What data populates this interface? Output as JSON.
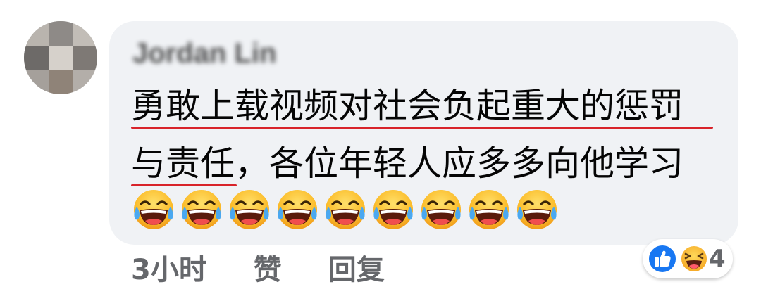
{
  "comment": {
    "author": "Jordan Lin",
    "text_line_1": "勇敢上载视频对社会负起重大的惩罚",
    "text_line_2": "与责任，各位年轻人应多多向他学习",
    "emojis": [
      "laughing-tears-icon",
      "laughing-tears-icon",
      "laughing-tears-icon",
      "laughing-tears-icon",
      "laughing-tears-icon",
      "laughing-tears-icon",
      "laughing-tears-icon",
      "laughing-tears-icon",
      "laughing-tears-icon"
    ]
  },
  "actions": {
    "time": "3小时",
    "like_label": "赞",
    "reply_label": "回复"
  },
  "reactions": {
    "icons": [
      "like-icon",
      "haha-icon"
    ],
    "count": "4",
    "like_color": "#1877f2",
    "haha_color": "#f7b125"
  },
  "colors": {
    "bubble_bg": "#f0f2f5",
    "spellcheck_underline": "#d8232a",
    "secondary_text": "#65676b"
  }
}
